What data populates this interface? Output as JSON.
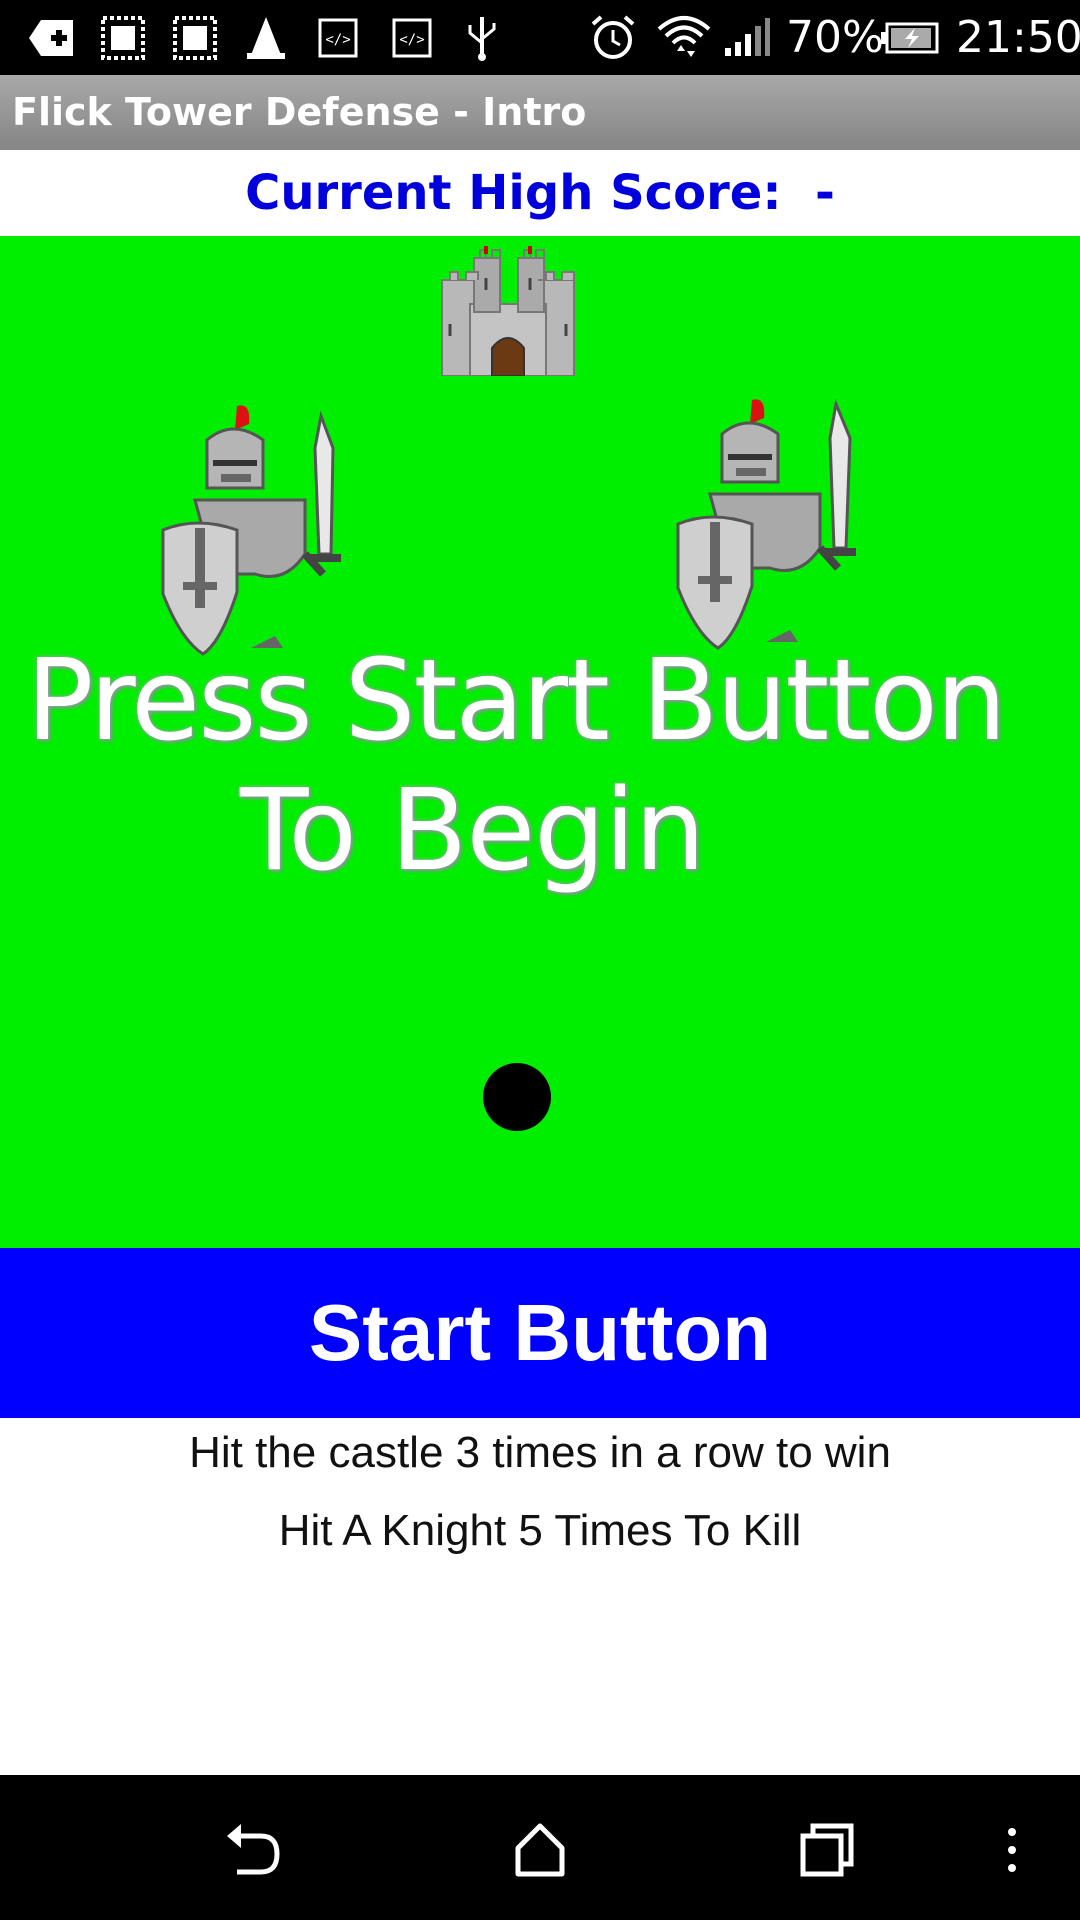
{
  "status_bar": {
    "battery_percent": "70%",
    "time": "21:50",
    "icons": [
      "add-icon",
      "photo-icon",
      "photo-icon",
      "cone-icon",
      "code-icon",
      "code-icon",
      "usb-icon",
      "alarm-icon",
      "wifi-icon",
      "signal-icon",
      "battery-charging-icon"
    ]
  },
  "app": {
    "title": "Flick Tower Defense - Intro"
  },
  "high_score": {
    "text": "Current High Score:  -"
  },
  "game": {
    "message_line1": "Press Start Button",
    "message_line2": "To Begin",
    "background_color": "#00ee00",
    "sprites": [
      "castle",
      "knight",
      "knight",
      "ball"
    ]
  },
  "start_button": {
    "label": "Start Button",
    "color": "#0000ff"
  },
  "instructions": {
    "line1": "Hit the castle 3 times in a row to win",
    "line2": "Hit A Knight 5 Times To Kill"
  },
  "nav_bar": {
    "icons": [
      "back-icon",
      "home-icon",
      "recents-icon",
      "menu-icon"
    ]
  }
}
